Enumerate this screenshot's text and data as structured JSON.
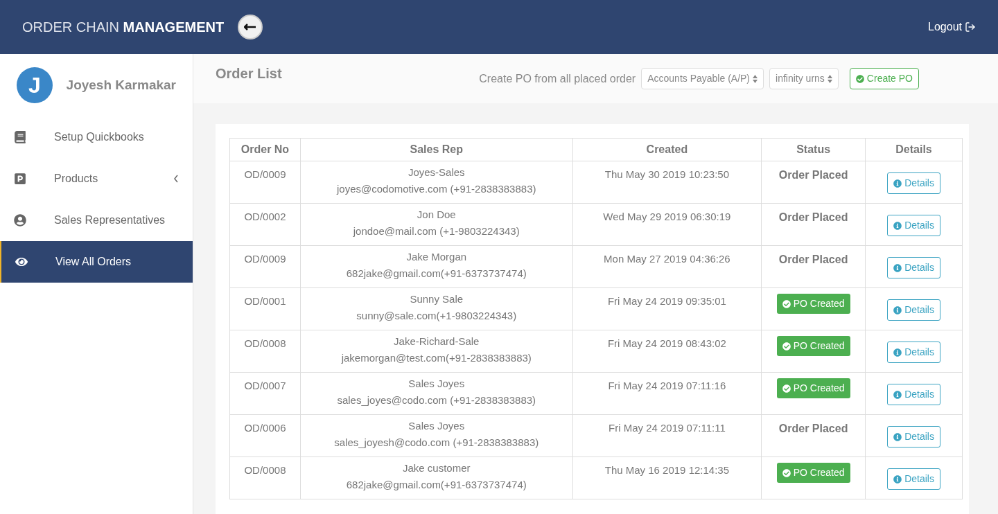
{
  "header": {
    "title_light": "ORDER CHAIN",
    "title_bold": "MANAGEMENT",
    "logout": "Logout"
  },
  "user": {
    "initial": "J",
    "name": "Joyesh Karmakar"
  },
  "sidebar": {
    "items": [
      {
        "label": "Setup Quickbooks",
        "selected": false,
        "has_submenu": false
      },
      {
        "label": "Products",
        "selected": false,
        "has_submenu": true
      },
      {
        "label": "Sales Representatives",
        "selected": false,
        "has_submenu": false
      },
      {
        "label": "View All Orders",
        "selected": true,
        "has_submenu": false
      }
    ]
  },
  "page": {
    "title": "Order List",
    "po_label": "Create PO from all placed order",
    "account_select": "Accounts Payable (A/P)",
    "vendor_select": "infinity urns",
    "create_button": "Create PO"
  },
  "table": {
    "columns": [
      "Order No",
      "Sales Rep",
      "Created",
      "Status",
      "Details"
    ],
    "rows": [
      {
        "order_no": "OD/0009",
        "rep_name": "Joyes-Sales",
        "rep_contact": "joyes@codomotive.com (+91-2838383883)",
        "created": "Thu May 30 2019 10:23:50",
        "status": {
          "kind": "placed",
          "label": "Order Placed"
        },
        "details": "Details"
      },
      {
        "order_no": "OD/0002",
        "rep_name": "Jon Doe",
        "rep_contact": "jondoe@mail.com (+1-9803224343)",
        "created": "Wed May 29 2019 06:30:19",
        "status": {
          "kind": "placed",
          "label": "Order Placed"
        },
        "details": "Details"
      },
      {
        "order_no": "OD/0009",
        "rep_name": "Jake Morgan",
        "rep_contact": "682jake@gmail.com(+91-6373737474)",
        "created": "Mon May 27 2019 04:36:26",
        "status": {
          "kind": "placed",
          "label": "Order Placed"
        },
        "details": "Details"
      },
      {
        "order_no": "OD/0001",
        "rep_name": "Sunny Sale",
        "rep_contact": "sunny@sale.com(+1-9803224343)",
        "created": "Fri May 24 2019 09:35:01",
        "status": {
          "kind": "po_created",
          "label": "PO Created"
        },
        "details": "Details"
      },
      {
        "order_no": "OD/0008",
        "rep_name": "Jake-Richard-Sale",
        "rep_contact": "jakemorgan@test.com(+91-2838383883)",
        "created": "Fri May 24 2019 08:43:02",
        "status": {
          "kind": "po_created",
          "label": "PO Created"
        },
        "details": "Details"
      },
      {
        "order_no": "OD/0007",
        "rep_name": "Sales Joyes",
        "rep_contact": "sales_joyes@codo.com (+91-2838383883)",
        "created": "Fri May 24 2019 07:11:16",
        "status": {
          "kind": "po_created",
          "label": "PO Created"
        },
        "details": "Details"
      },
      {
        "order_no": "OD/0006",
        "rep_name": "Sales Joyes",
        "rep_contact": "sales_joyesh@codo.com (+91-2838383883)",
        "created": "Fri May 24 2019 07:11:11",
        "status": {
          "kind": "placed",
          "label": "Order Placed"
        },
        "details": "Details"
      },
      {
        "order_no": "OD/0008",
        "rep_name": "Jake customer",
        "rep_contact": "682jake@gmail.com(+91-6373737474)",
        "created": "Thu May 16 2019 12:14:35",
        "status": {
          "kind": "po_created",
          "label": "PO Created"
        },
        "details": "Details"
      }
    ]
  }
}
